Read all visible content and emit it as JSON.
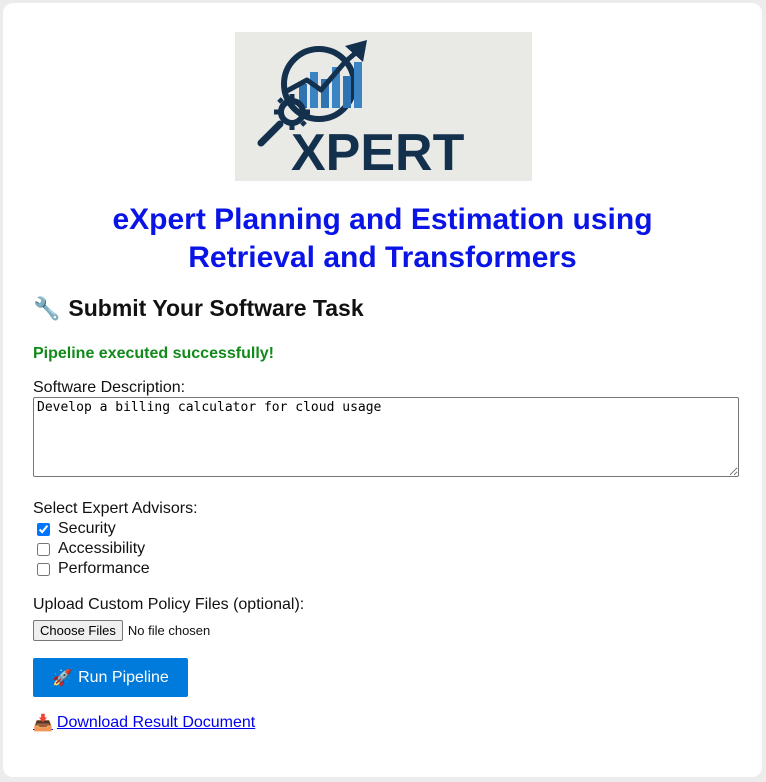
{
  "logo": {
    "text": "XPERT"
  },
  "title_line1": "eXpert Planning and Estimation using",
  "title_line2": "Retrieval and Transformers",
  "section": {
    "icon": "wrench-icon",
    "heading": "Submit Your Software Task"
  },
  "status": {
    "message": "Pipeline executed successfully!",
    "color": "#118a1a"
  },
  "description": {
    "label": "Software Description:",
    "value": "Develop a billing calculator for cloud usage"
  },
  "advisors": {
    "label": "Select Expert Advisors:",
    "items": [
      {
        "label": "Security",
        "checked": true
      },
      {
        "label": "Accessibility",
        "checked": false
      },
      {
        "label": "Performance",
        "checked": false
      }
    ]
  },
  "upload": {
    "label": "Upload Custom Policy Files (optional):",
    "button_label": "Choose Files",
    "status": "No file chosen"
  },
  "run_button": {
    "icon": "rocket-icon",
    "label": "Run Pipeline",
    "color": "#007bdb"
  },
  "download": {
    "icon": "inbox-tray-icon",
    "label": "Download Result Document"
  },
  "colors": {
    "title": "#0a14e6",
    "logo_navy": "#13304d",
    "logo_blue": "#2f73b0"
  }
}
